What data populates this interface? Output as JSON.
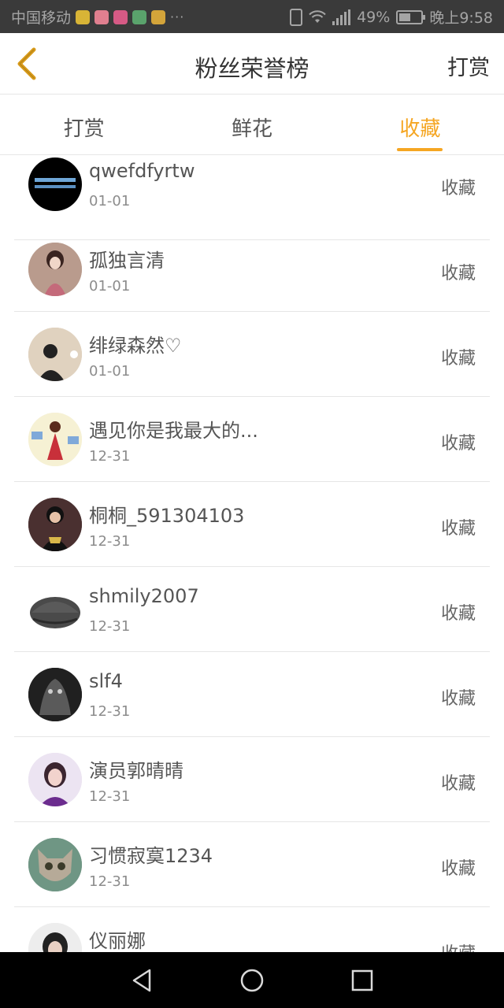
{
  "status_bar": {
    "carrier": "中国移动",
    "more": "···",
    "battery": "49%",
    "time": "晚上9:58"
  },
  "header": {
    "title": "粉丝荣誉榜",
    "action": "打赏"
  },
  "tabs": [
    {
      "label": "打赏",
      "active": false
    },
    {
      "label": "鲜花",
      "active": false
    },
    {
      "label": "收藏",
      "active": true
    }
  ],
  "list": [
    {
      "name": "qwefdfyrtw",
      "date": "01-01",
      "action": "收藏"
    },
    {
      "name": "孤独言清",
      "date": "01-01",
      "action": "收藏"
    },
    {
      "name": "绯绿森然♡",
      "date": "01-01",
      "action": "收藏"
    },
    {
      "name": "遇见你是我最大的...",
      "date": "12-31",
      "action": "收藏"
    },
    {
      "name": "桐桐_591304103",
      "date": "12-31",
      "action": "收藏"
    },
    {
      "name": "shmily2007",
      "date": "12-31",
      "action": "收藏"
    },
    {
      "name": "slf4",
      "date": "12-31",
      "action": "收藏"
    },
    {
      "name": "演员郭晴晴",
      "date": "12-31",
      "action": "收藏"
    },
    {
      "name": "习惯寂寞1234",
      "date": "12-31",
      "action": "收藏"
    },
    {
      "name": "仪丽娜",
      "date": "",
      "action": "收藏"
    }
  ],
  "colors": {
    "accent": "#f5a623",
    "back_arrow": "#d89b1b"
  }
}
